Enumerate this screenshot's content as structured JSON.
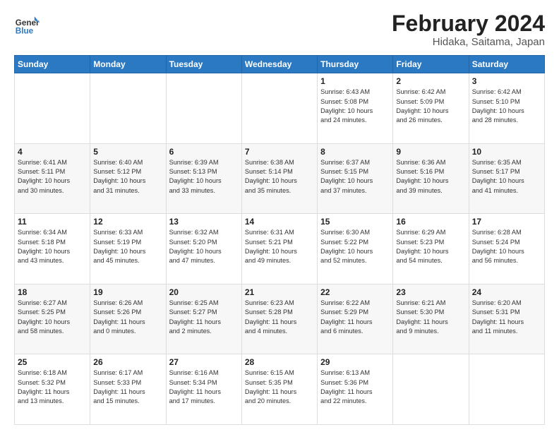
{
  "header": {
    "logo_general": "General",
    "logo_blue": "Blue",
    "title": "February 2024",
    "subtitle": "Hidaka, Saitama, Japan"
  },
  "weekdays": [
    "Sunday",
    "Monday",
    "Tuesday",
    "Wednesday",
    "Thursday",
    "Friday",
    "Saturday"
  ],
  "weeks": [
    [
      {
        "day": "",
        "info": ""
      },
      {
        "day": "",
        "info": ""
      },
      {
        "day": "",
        "info": ""
      },
      {
        "day": "",
        "info": ""
      },
      {
        "day": "1",
        "info": "Sunrise: 6:43 AM\nSunset: 5:08 PM\nDaylight: 10 hours\nand 24 minutes."
      },
      {
        "day": "2",
        "info": "Sunrise: 6:42 AM\nSunset: 5:09 PM\nDaylight: 10 hours\nand 26 minutes."
      },
      {
        "day": "3",
        "info": "Sunrise: 6:42 AM\nSunset: 5:10 PM\nDaylight: 10 hours\nand 28 minutes."
      }
    ],
    [
      {
        "day": "4",
        "info": "Sunrise: 6:41 AM\nSunset: 5:11 PM\nDaylight: 10 hours\nand 30 minutes."
      },
      {
        "day": "5",
        "info": "Sunrise: 6:40 AM\nSunset: 5:12 PM\nDaylight: 10 hours\nand 31 minutes."
      },
      {
        "day": "6",
        "info": "Sunrise: 6:39 AM\nSunset: 5:13 PM\nDaylight: 10 hours\nand 33 minutes."
      },
      {
        "day": "7",
        "info": "Sunrise: 6:38 AM\nSunset: 5:14 PM\nDaylight: 10 hours\nand 35 minutes."
      },
      {
        "day": "8",
        "info": "Sunrise: 6:37 AM\nSunset: 5:15 PM\nDaylight: 10 hours\nand 37 minutes."
      },
      {
        "day": "9",
        "info": "Sunrise: 6:36 AM\nSunset: 5:16 PM\nDaylight: 10 hours\nand 39 minutes."
      },
      {
        "day": "10",
        "info": "Sunrise: 6:35 AM\nSunset: 5:17 PM\nDaylight: 10 hours\nand 41 minutes."
      }
    ],
    [
      {
        "day": "11",
        "info": "Sunrise: 6:34 AM\nSunset: 5:18 PM\nDaylight: 10 hours\nand 43 minutes."
      },
      {
        "day": "12",
        "info": "Sunrise: 6:33 AM\nSunset: 5:19 PM\nDaylight: 10 hours\nand 45 minutes."
      },
      {
        "day": "13",
        "info": "Sunrise: 6:32 AM\nSunset: 5:20 PM\nDaylight: 10 hours\nand 47 minutes."
      },
      {
        "day": "14",
        "info": "Sunrise: 6:31 AM\nSunset: 5:21 PM\nDaylight: 10 hours\nand 49 minutes."
      },
      {
        "day": "15",
        "info": "Sunrise: 6:30 AM\nSunset: 5:22 PM\nDaylight: 10 hours\nand 52 minutes."
      },
      {
        "day": "16",
        "info": "Sunrise: 6:29 AM\nSunset: 5:23 PM\nDaylight: 10 hours\nand 54 minutes."
      },
      {
        "day": "17",
        "info": "Sunrise: 6:28 AM\nSunset: 5:24 PM\nDaylight: 10 hours\nand 56 minutes."
      }
    ],
    [
      {
        "day": "18",
        "info": "Sunrise: 6:27 AM\nSunset: 5:25 PM\nDaylight: 10 hours\nand 58 minutes."
      },
      {
        "day": "19",
        "info": "Sunrise: 6:26 AM\nSunset: 5:26 PM\nDaylight: 11 hours\nand 0 minutes."
      },
      {
        "day": "20",
        "info": "Sunrise: 6:25 AM\nSunset: 5:27 PM\nDaylight: 11 hours\nand 2 minutes."
      },
      {
        "day": "21",
        "info": "Sunrise: 6:23 AM\nSunset: 5:28 PM\nDaylight: 11 hours\nand 4 minutes."
      },
      {
        "day": "22",
        "info": "Sunrise: 6:22 AM\nSunset: 5:29 PM\nDaylight: 11 hours\nand 6 minutes."
      },
      {
        "day": "23",
        "info": "Sunrise: 6:21 AM\nSunset: 5:30 PM\nDaylight: 11 hours\nand 9 minutes."
      },
      {
        "day": "24",
        "info": "Sunrise: 6:20 AM\nSunset: 5:31 PM\nDaylight: 11 hours\nand 11 minutes."
      }
    ],
    [
      {
        "day": "25",
        "info": "Sunrise: 6:18 AM\nSunset: 5:32 PM\nDaylight: 11 hours\nand 13 minutes."
      },
      {
        "day": "26",
        "info": "Sunrise: 6:17 AM\nSunset: 5:33 PM\nDaylight: 11 hours\nand 15 minutes."
      },
      {
        "day": "27",
        "info": "Sunrise: 6:16 AM\nSunset: 5:34 PM\nDaylight: 11 hours\nand 17 minutes."
      },
      {
        "day": "28",
        "info": "Sunrise: 6:15 AM\nSunset: 5:35 PM\nDaylight: 11 hours\nand 20 minutes."
      },
      {
        "day": "29",
        "info": "Sunrise: 6:13 AM\nSunset: 5:36 PM\nDaylight: 11 hours\nand 22 minutes."
      },
      {
        "day": "",
        "info": ""
      },
      {
        "day": "",
        "info": ""
      }
    ]
  ]
}
